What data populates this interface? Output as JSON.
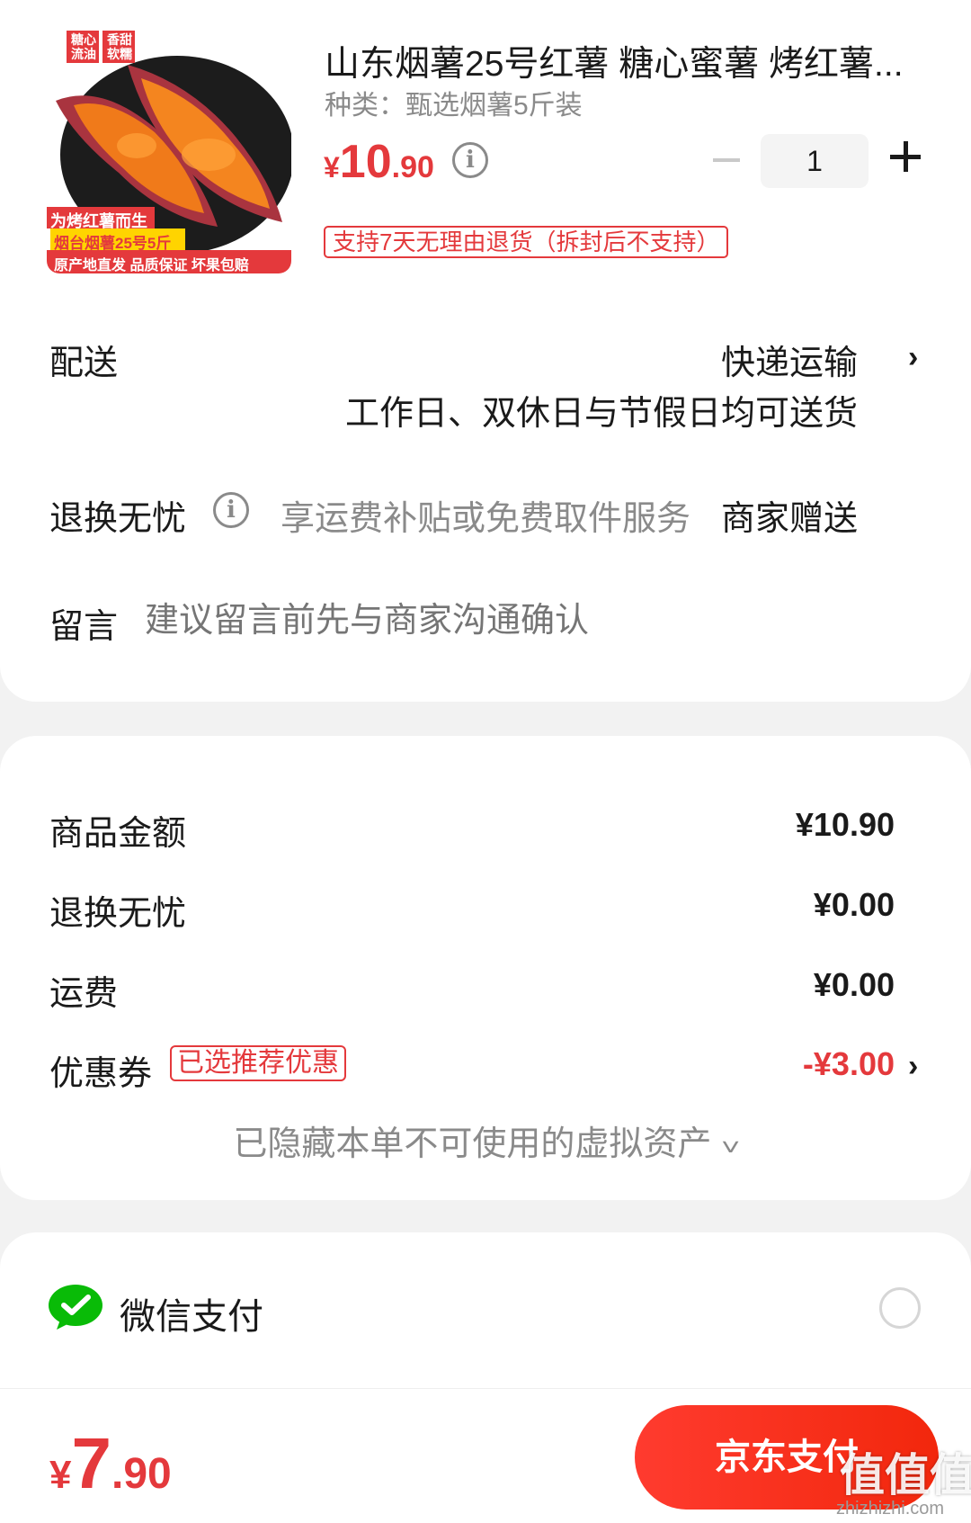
{
  "product": {
    "title": "山东烟薯25号红薯 糖心蜜薯 烤红薯...",
    "spec": "种类：甄选烟薯5斤装",
    "price_currency": "¥",
    "price_int": "10",
    "price_dec": ".90",
    "quantity": "1",
    "return_badge": "支持7天无理由退货（拆封后不支持）",
    "image_icon": "roasted-sweet-potato-image",
    "image_labels": {
      "tag1": "糖心流油",
      "tag2": "香甜软糯",
      "line1": "为烤红薯而生",
      "line2": "烟台烟薯25号5斤",
      "line3": "原产地直发 品质保证 坏果包赔"
    }
  },
  "delivery": {
    "label": "配送",
    "value": "快递运输",
    "sub": "工作日、双休日与节假日均可送货"
  },
  "return_service": {
    "label": "退换无忧",
    "desc": "享运费补贴或免费取件服务",
    "value": "商家赠送"
  },
  "message": {
    "label": "留言",
    "placeholder": "建议留言前先与商家沟通确认"
  },
  "summary": {
    "goods_label": "商品金额",
    "goods_amount": "¥10.90",
    "return_label": "退换无忧",
    "return_amount": "¥0.00",
    "freight_label": "运费",
    "freight_amount": "¥0.00",
    "coupon_label": "优惠券",
    "coupon_badge": "已选推荐优惠",
    "coupon_amount": "-¥3.00",
    "hidden_assets": "已隐藏本单不可使用的虚拟资产"
  },
  "payment": {
    "method_label": "微信支付",
    "method_icon": "wechat-pay-icon"
  },
  "footer": {
    "total_currency": "¥",
    "total_int": "7",
    "total_dec": ".90",
    "pay_button": "京东支付"
  },
  "watermark": {
    "main": "值值值",
    "sub": "zhizhizhi.com"
  },
  "colors": {
    "accent": "#e4393c",
    "button": "#f2270c",
    "wechat": "#09bb07"
  }
}
